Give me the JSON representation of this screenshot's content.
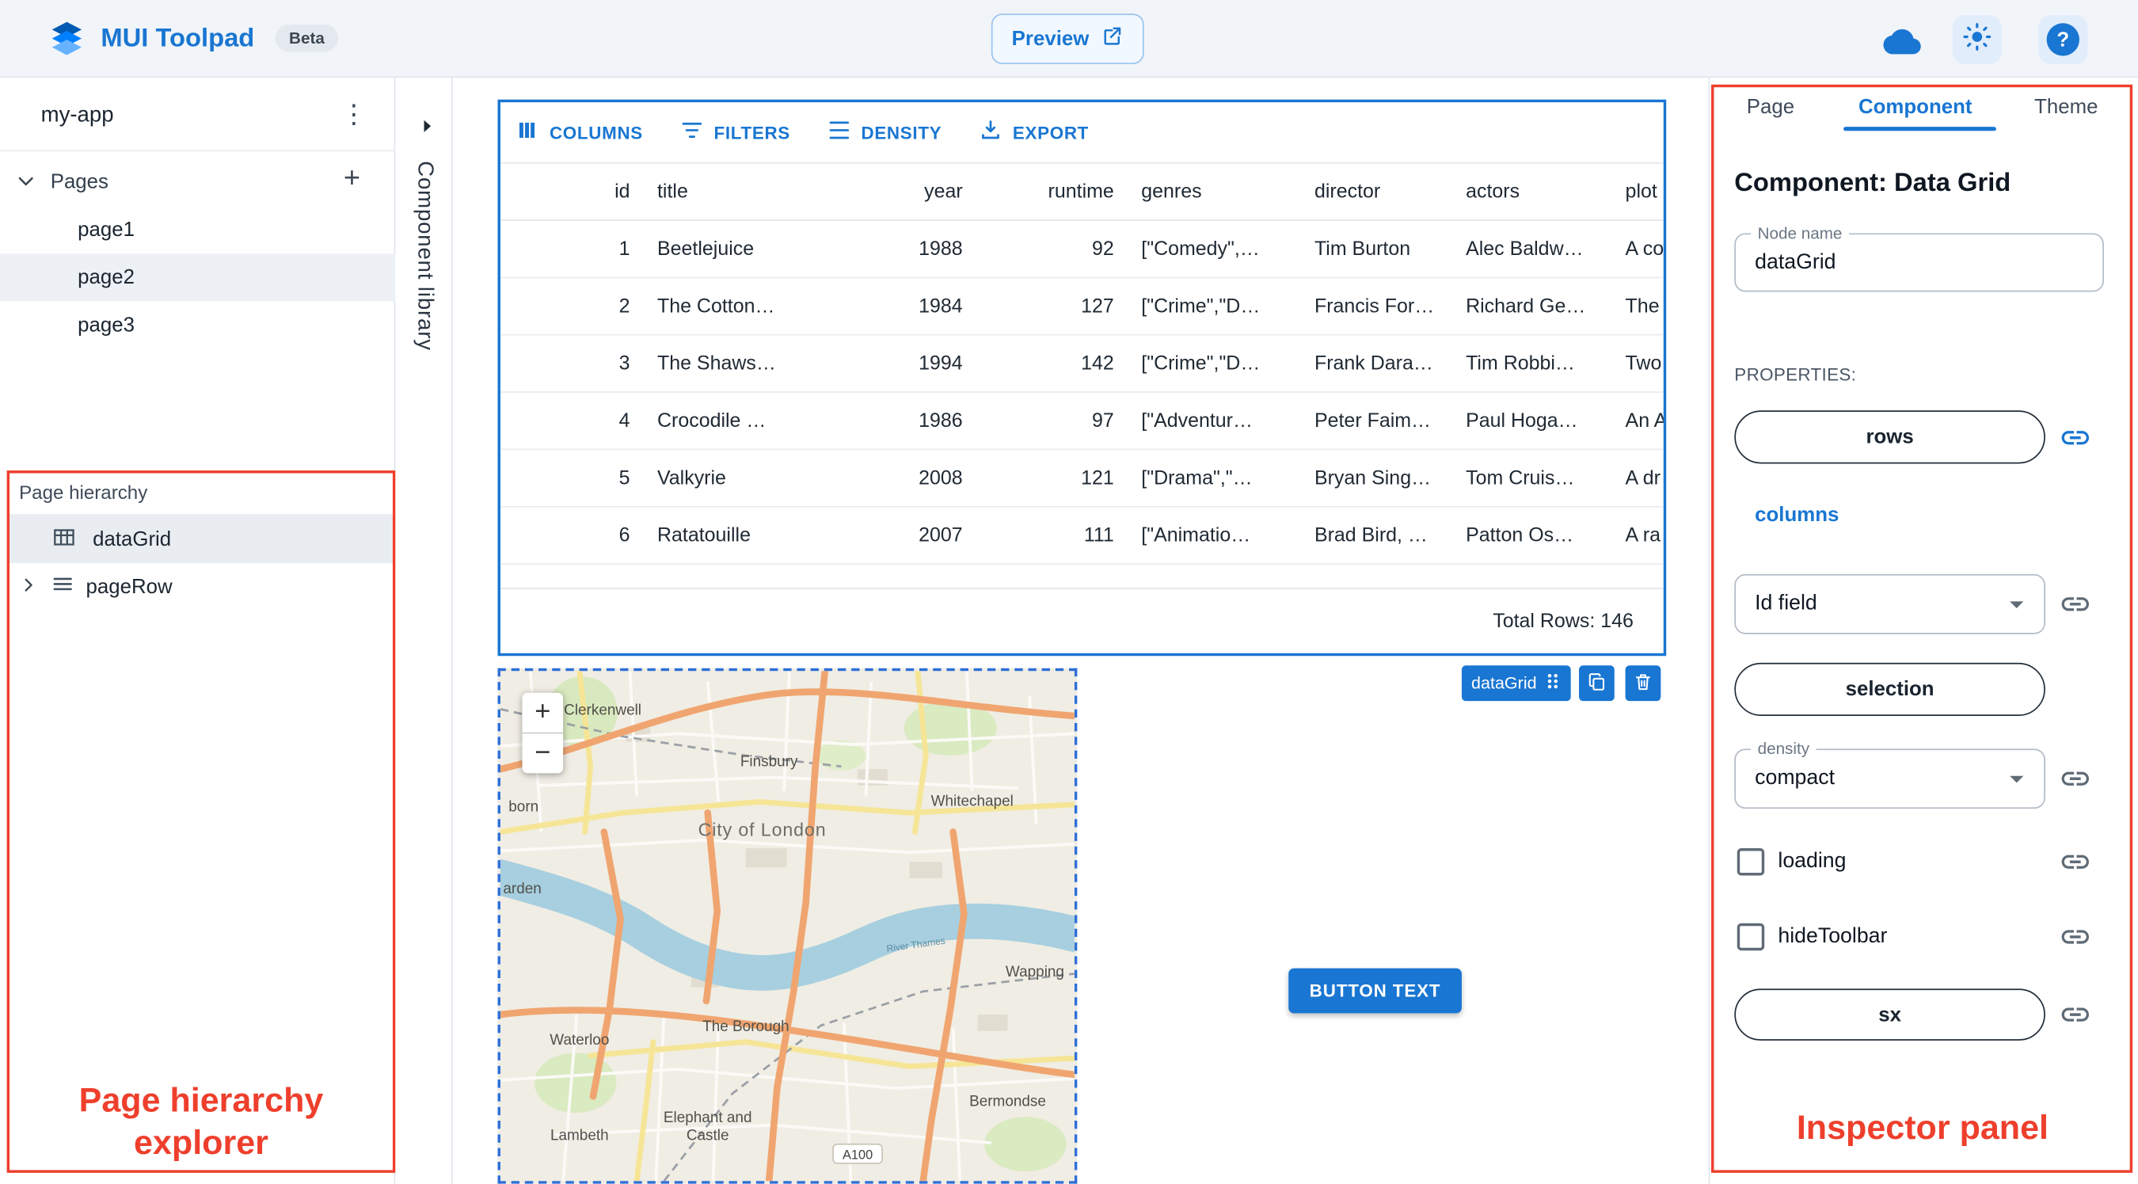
{
  "app_bar": {
    "title": "MUI Toolpad",
    "beta": "Beta",
    "preview": "Preview"
  },
  "icons": {
    "kebab": "⋮",
    "plus": "+",
    "help": "?"
  },
  "sidebar": {
    "app_name": "my-app",
    "pages_label": "Pages",
    "pages": [
      {
        "label": "page1"
      },
      {
        "label": "page2"
      },
      {
        "label": "page3"
      }
    ],
    "hierarchy_title": "Page hierarchy",
    "hierarchy": [
      {
        "label": "dataGrid"
      },
      {
        "label": "pageRow"
      }
    ]
  },
  "component_library": {
    "label": "Component library"
  },
  "datagrid": {
    "toolbar": {
      "columns": "COLUMNS",
      "filters": "FILTERS",
      "density": "DENSITY",
      "export": "EXPORT"
    },
    "headers": [
      "id",
      "title",
      "year",
      "runtime",
      "genres",
      "director",
      "actors",
      "plot"
    ],
    "rows": [
      [
        "1",
        "Beetlejuice",
        "1988",
        "92",
        "[\"Comedy\",…",
        "Tim Burton",
        "Alec Baldw…",
        "A co"
      ],
      [
        "2",
        "The Cotton…",
        "1984",
        "127",
        "[\"Crime\",\"D…",
        "Francis For…",
        "Richard Ge…",
        "The"
      ],
      [
        "3",
        "The Shaws…",
        "1994",
        "142",
        "[\"Crime\",\"D…",
        "Frank Dara…",
        "Tim Robbi…",
        "Two"
      ],
      [
        "4",
        "Crocodile …",
        "1986",
        "97",
        "[\"Adventur…",
        "Peter Faim…",
        "Paul Hoga…",
        "An A"
      ],
      [
        "5",
        "Valkyrie",
        "2008",
        "121",
        "[\"Drama\",\"…",
        "Bryan Sing…",
        "Tom Cruis…",
        "A dr"
      ],
      [
        "6",
        "Ratatouille",
        "2007",
        "111",
        "[\"Animatio…",
        "Brad Bird, …",
        "Patton Os…",
        "A ra"
      ]
    ],
    "footer": "Total Rows: 146",
    "selection_label": "dataGrid"
  },
  "map": {
    "zoom_in": "+",
    "zoom_out": "−",
    "labels": {
      "clerkenwell": "Clerkenwell",
      "finsbury": "Finsbury",
      "whitechapel": "Whitechapel",
      "city": "City of London",
      "wapping": "Wapping",
      "waterloo": "Waterloo",
      "borough": "The Borough",
      "lambeth": "Lambeth",
      "elephant_1": "Elephant and",
      "elephant_2": "Castle",
      "bermondsey": "Bermondse",
      "born": "born",
      "arden": "arden",
      "river": "River Thames",
      "road_badge": "A100"
    }
  },
  "button": {
    "label": "BUTTON TEXT"
  },
  "inspector": {
    "tabs": [
      {
        "label": "Page"
      },
      {
        "label": "Component"
      },
      {
        "label": "Theme"
      }
    ],
    "heading": "Component: Data Grid",
    "node_name_label": "Node name",
    "node_name_value": "dataGrid",
    "properties_label": "PROPERTIES:",
    "rows_button": "rows",
    "columns_button": "columns",
    "id_field": "Id field",
    "selection_button": "selection",
    "density_label": "density",
    "density_value": "compact",
    "loading_label": "loading",
    "hide_toolbar_label": "hideToolbar",
    "sx_button": "sx"
  },
  "annotations": {
    "hierarchy_label": "Page hierarchy explorer",
    "inspector_label": "Inspector panel"
  },
  "colors": {
    "accent": "#1976d2",
    "annotation": "#ee3f2c",
    "appbar_bg": "#f1f4f8"
  }
}
